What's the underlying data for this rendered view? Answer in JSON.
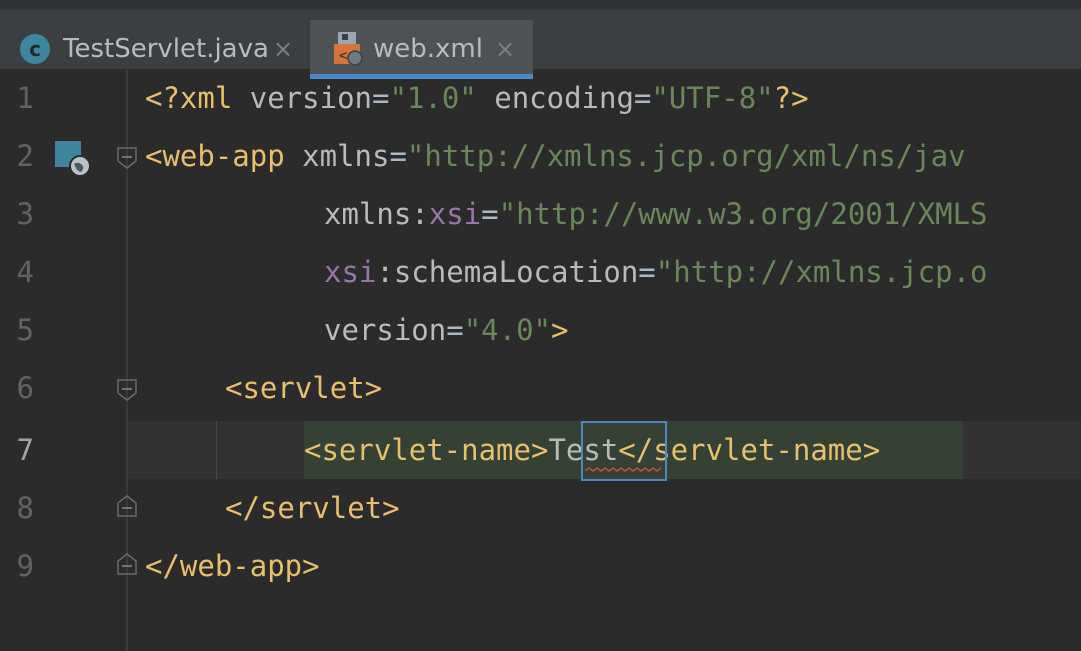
{
  "tabs": [
    {
      "label": "TestServlet.java",
      "icon": "class-icon",
      "icon_letter": "c",
      "active": false
    },
    {
      "label": "web.xml",
      "icon": "xml-file-icon",
      "active": true
    }
  ],
  "close_glyph": "×",
  "editor": {
    "lines": [
      {
        "number": "1"
      },
      {
        "number": "2"
      },
      {
        "number": "3"
      },
      {
        "number": "4"
      },
      {
        "number": "5"
      },
      {
        "number": "6"
      },
      {
        "number": "7"
      },
      {
        "number": "8"
      },
      {
        "number": "9"
      }
    ],
    "active_line": "7",
    "code": {
      "l1": {
        "open": "<?xml ",
        "a1": "version",
        "eq1": "=",
        "v1": "\"1.0\"",
        "sp": " ",
        "a2": "encoding",
        "eq2": "=",
        "v2": "\"UTF-8\"",
        "close": "?>"
      },
      "l2": {
        "open": "<web-app ",
        "a1": "xmlns",
        "eq1": "=",
        "v1": "\"http://xmlns.jcp.org/xml/ns/jav"
      },
      "l3": {
        "a1": "xmlns:",
        "ns": "xsi",
        "eq1": "=",
        "v1": "\"http://www.w3.org/2001/XMLS"
      },
      "l4": {
        "ns": "xsi",
        "a1": ":schemaLocation",
        "eq1": "=",
        "v1": "\"http://xmlns.jcp.o"
      },
      "l5": {
        "a1": "version",
        "eq1": "=",
        "v1": "\"4.0\"",
        "close": ">"
      },
      "l6": {
        "tag": "<servlet>"
      },
      "l7": {
        "open": "<servlet-name>",
        "text": "Test",
        "close": "</servlet-name>"
      },
      "l8": {
        "tag": "</servlet>"
      },
      "l9": {
        "tag": "</web-app>"
      }
    }
  },
  "colors": {
    "tag": "#e8bf6a",
    "attribute": "#bababa",
    "string": "#6a8759",
    "namespace": "#9876aa",
    "accent": "#4a88c7"
  }
}
